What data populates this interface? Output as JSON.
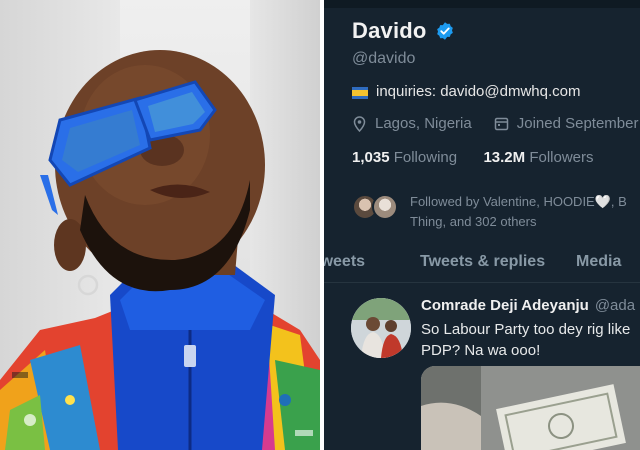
{
  "profile": {
    "display_name": "Davido",
    "handle": "@davido",
    "bio": "inquiries: davido@dmwhq.com",
    "location": "Lagos, Nigeria",
    "joined": "Joined September",
    "following_count": "1,035",
    "following_label": "Following",
    "followers_count": "13.2M",
    "followers_label": "Followers",
    "followed_by_line1": "Followed by Valentine, HOODIE🤍, B",
    "followed_by_line2": "Thing, and 302 others"
  },
  "tabs": [
    {
      "label": "Tweets"
    },
    {
      "label": "Tweets & replies"
    },
    {
      "label": "Media"
    }
  ],
  "tweet": {
    "author": "Comrade Deji Adeyanju",
    "author_handle": "@ada",
    "text": "So Labour Party too dey rig like PDP? Na wa ooo!"
  },
  "icons": {
    "verified": "verified-badge-icon",
    "flag": "flag-icon",
    "location": "location-pin-icon",
    "calendar": "calendar-icon"
  },
  "colors": {
    "background": "#16232f",
    "verified_blue": "#1d9bf0",
    "muted_text": "#7f8c99"
  }
}
